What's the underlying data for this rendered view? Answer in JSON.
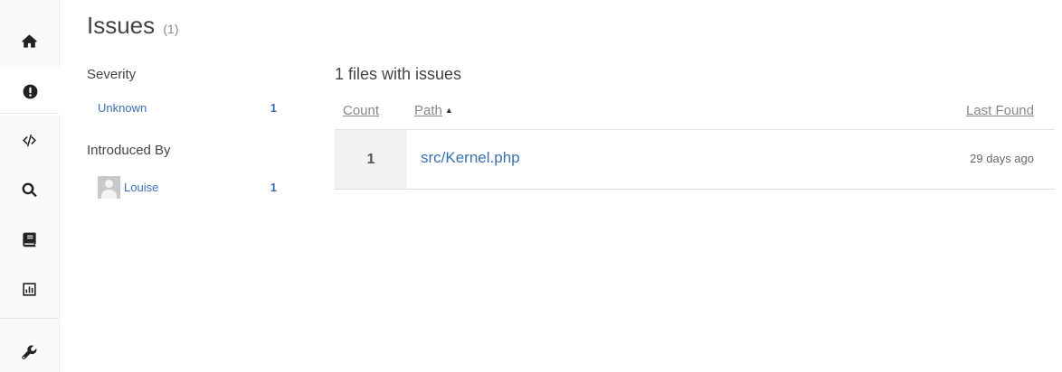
{
  "sidebar": {
    "items": [
      {
        "icon": "home-icon",
        "active": false
      },
      {
        "icon": "exclamation-circle-icon",
        "active": true
      },
      {
        "icon": "code-icon",
        "active": false
      },
      {
        "icon": "search-icon",
        "active": false
      },
      {
        "icon": "book-icon",
        "active": false
      },
      {
        "icon": "bar-chart-icon",
        "active": false
      },
      {
        "icon": "wrench-icon",
        "active": false
      }
    ]
  },
  "page": {
    "title": "Issues",
    "count": "(1)"
  },
  "filters": {
    "severity": {
      "heading": "Severity",
      "items": [
        {
          "label": "Unknown",
          "count": "1"
        }
      ]
    },
    "introduced_by": {
      "heading": "Introduced By",
      "items": [
        {
          "label": "Louise",
          "count": "1"
        }
      ]
    }
  },
  "results": {
    "heading": "1 files with issues",
    "columns": {
      "count": "Count",
      "path": "Path",
      "last_found": "Last Found"
    },
    "sort": {
      "column": "path",
      "direction": "ascending"
    },
    "rows": [
      {
        "count": "1",
        "path": "src/Kernel.php",
        "last_found": "29 days ago"
      }
    ]
  },
  "colors": {
    "link": "#3a6fb0",
    "row_count_bg": "#f2f2f2"
  }
}
